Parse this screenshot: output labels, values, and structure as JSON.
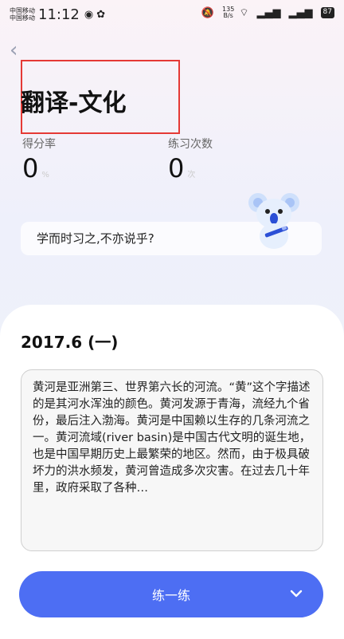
{
  "status": {
    "carrier1": "中国移动",
    "carrier2": "中国移动",
    "time": "11:12",
    "speed_value": "135",
    "speed_unit": "B/s",
    "battery": "87"
  },
  "header": {
    "title": "翻译-文化"
  },
  "stats": {
    "score_label": "得分率",
    "score_value": "0",
    "score_unit": "%",
    "count_label": "练习次数",
    "count_value": "0",
    "count_unit": "次"
  },
  "motto": "学而时习之,不亦说乎?",
  "section": {
    "title": "2017.6 (一)",
    "passage": "黄河是亚洲第三、世界第六长的河流。“黄”这个字描述的是其河水浑浊的颜色。黄河发源于青海，流经九个省份，最后注入渤海。黄河是中国赖以生存的几条河流之一。黄河流域(river basin)是中国古代文明的诞生地，也是中国早期历史上最繁荣的地区。然而，由于极具破坏力的洪水频发，黄河曾造成多次灾害。在过去几十年里，政府采取了各种…"
  },
  "actions": {
    "practice_label": "练一练"
  },
  "colors": {
    "accent": "#4d6ef3",
    "highlight_box": "#e53935"
  }
}
